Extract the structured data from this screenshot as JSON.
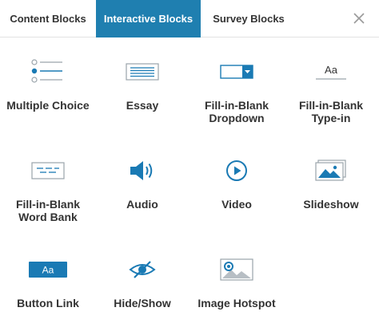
{
  "tabs": {
    "content": "Content Blocks",
    "interactive": "Interactive Blocks",
    "survey": "Survey Blocks"
  },
  "colors": {
    "accent": "#1f7fb0",
    "icon_blue": "#1a7ab4",
    "text": "#333333",
    "border": "#e2e2e2"
  },
  "blocks": [
    {
      "label": "Multiple Choice",
      "icon": "multiple-choice-icon"
    },
    {
      "label": "Essay",
      "icon": "essay-icon"
    },
    {
      "label": "Fill-in-Blank\nDropdown",
      "icon": "dropdown-icon"
    },
    {
      "label": "Fill-in-Blank\nType-in",
      "icon": "type-in-icon",
      "icon_text": "Aa"
    },
    {
      "label": "Fill-in-Blank\nWord Bank",
      "icon": "word-bank-icon"
    },
    {
      "label": "Audio",
      "icon": "speaker-icon"
    },
    {
      "label": "Video",
      "icon": "play-icon"
    },
    {
      "label": "Slideshow",
      "icon": "slideshow-icon"
    },
    {
      "label": "Button Link",
      "icon": "button-icon",
      "icon_text": "Aa"
    },
    {
      "label": "Hide/Show",
      "icon": "eye-icon"
    },
    {
      "label": "Image Hotspot",
      "icon": "image-hotspot-icon"
    }
  ]
}
